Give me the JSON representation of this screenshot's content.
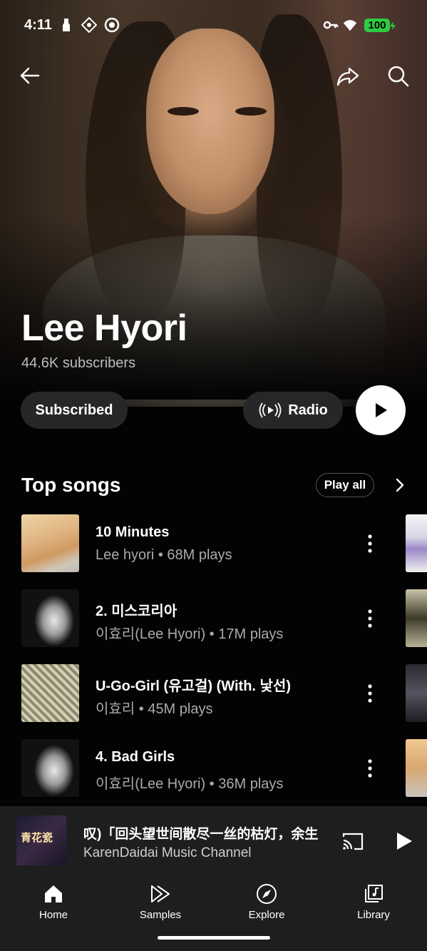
{
  "status_bar": {
    "time": "4:11",
    "battery": "100"
  },
  "artist": {
    "name": "Lee Hyori",
    "subscribers": "44.6K subscribers"
  },
  "actions": {
    "subscribed_label": "Subscribed",
    "radio_label": "Radio"
  },
  "top_songs": {
    "heading": "Top songs",
    "play_all_label": "Play all",
    "songs": [
      {
        "title": "10 Minutes",
        "meta": "Lee hyori • 68M plays"
      },
      {
        "title": "2. 미스코리아",
        "meta": "이효리(Lee Hyori) • 17M plays"
      },
      {
        "title": "U-Go-Girl (유고걸) (With. 낯선)",
        "meta": "이효리 • 45M plays"
      },
      {
        "title": "4. Bad Girls",
        "meta": "이효리(Lee Hyori) • 36M plays"
      }
    ]
  },
  "mini_player": {
    "title": "叹)「回头望世间散尽一丝的枯灯，余生",
    "channel": "KarenDaidai Music Channel",
    "thumb_text": "青花瓷"
  },
  "bottom_nav": [
    {
      "label": "Home",
      "icon": "home-icon"
    },
    {
      "label": "Samples",
      "icon": "samples-icon"
    },
    {
      "label": "Explore",
      "icon": "explore-icon"
    },
    {
      "label": "Library",
      "icon": "library-icon"
    }
  ],
  "colors": {
    "background": "#030303",
    "pill": "#272727",
    "battery": "#2ecc40",
    "secondary_text": "#aaaaaa"
  }
}
